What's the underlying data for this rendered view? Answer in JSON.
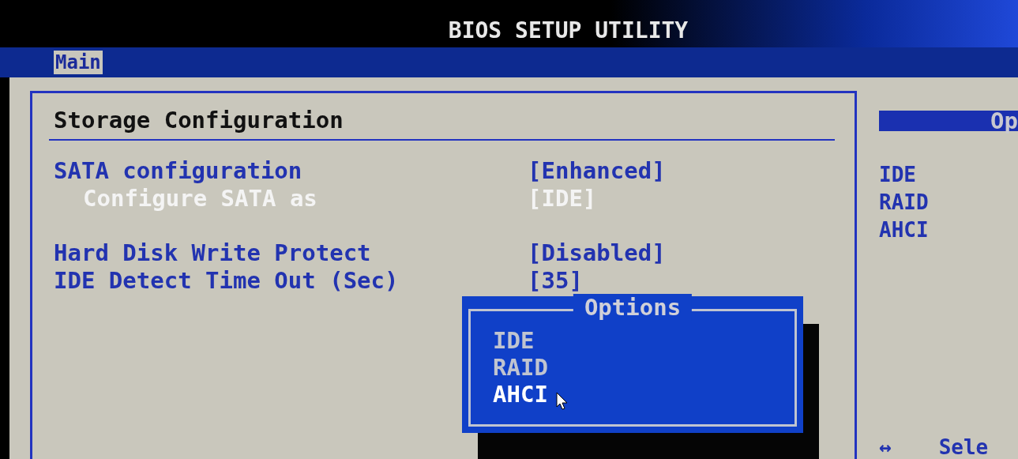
{
  "title": "BIOS SETUP UTILITY",
  "tabs": [
    {
      "label": "Main",
      "selected": true
    }
  ],
  "section": {
    "title": "Storage Configuration",
    "groups": [
      [
        {
          "label": "SATA configuration",
          "value": "[Enhanced]",
          "kind": "item",
          "selected": false
        },
        {
          "label": "Configure SATA as",
          "value": "[IDE]",
          "kind": "subitem",
          "selected": true
        }
      ],
      [
        {
          "label": "Hard Disk Write Protect",
          "value": "[Disabled]",
          "kind": "item",
          "selected": false
        },
        {
          "label": "IDE Detect Time Out (Sec)",
          "value": "[35]",
          "kind": "item",
          "selected": false
        }
      ]
    ]
  },
  "help_panel": {
    "title": "Op",
    "options": [
      "IDE",
      "RAID",
      "AHCI"
    ],
    "keys": [
      {
        "key": "↔",
        "action": "Sele"
      }
    ]
  },
  "popup": {
    "title": "Options",
    "items": [
      {
        "label": "IDE",
        "selected": false
      },
      {
        "label": "RAID",
        "selected": false
      },
      {
        "label": "AHCI",
        "selected": true
      }
    ]
  }
}
